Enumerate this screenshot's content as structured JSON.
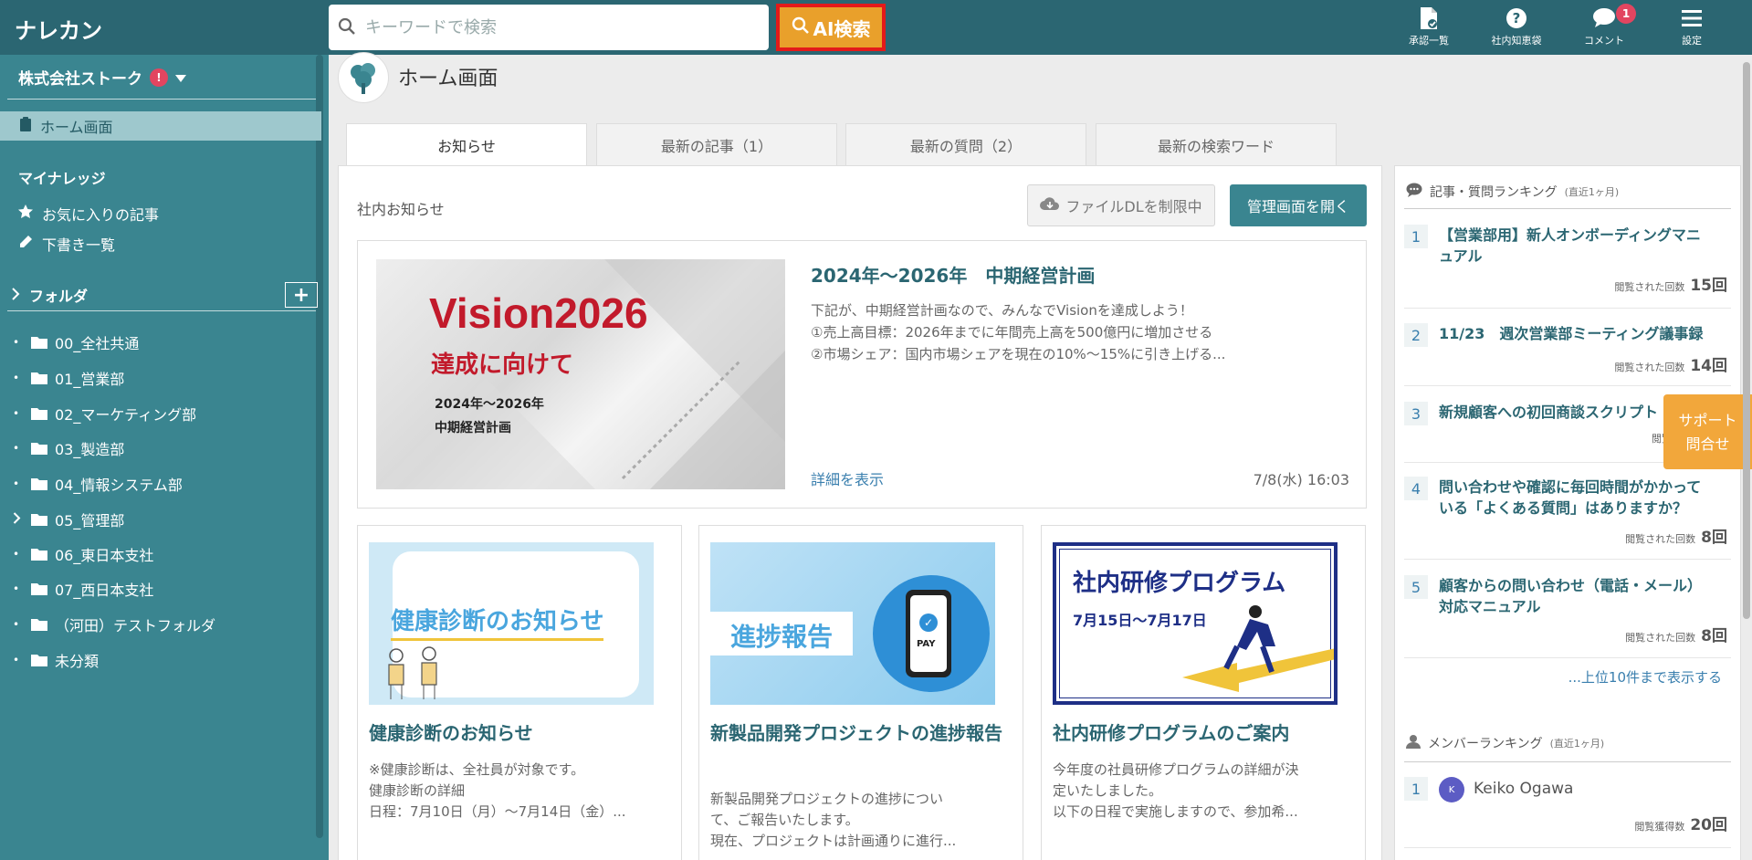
{
  "app": {
    "logo": "ナレカン"
  },
  "topbar": {
    "search_placeholder": "キーワードで検索",
    "ai_search_label": "AI検索",
    "nav": [
      {
        "label": "承認一覧",
        "icon": "approval-document-icon"
      },
      {
        "label": "社内知恵袋",
        "icon": "question-circle-icon"
      },
      {
        "label": "コメント",
        "icon": "comment-bubble-icon",
        "badge": "1"
      },
      {
        "label": "設定",
        "icon": "hamburger-menu-icon"
      }
    ]
  },
  "sidebar": {
    "company": "株式会社ストーク",
    "company_badge": "!",
    "home": "ホーム画面",
    "my_knowledge_title": "マイナレッジ",
    "favorites": "お気に入りの記事",
    "drafts": "下書き一覧",
    "folders_title": "フォルダ",
    "add_label": "+",
    "folders": [
      {
        "name": "00_全社共通",
        "expandable": false
      },
      {
        "name": "01_営業部",
        "expandable": false
      },
      {
        "name": "02_マーケティング部",
        "expandable": false
      },
      {
        "name": "03_製造部",
        "expandable": false
      },
      {
        "name": "04_情報システム部",
        "expandable": false
      },
      {
        "name": "05_管理部",
        "expandable": true
      },
      {
        "name": "06_東日本支社",
        "expandable": false
      },
      {
        "name": "07_西日本支社",
        "expandable": false
      },
      {
        "name": "（河田）テストフォルダ",
        "expandable": false
      },
      {
        "name": "未分類",
        "expandable": false
      }
    ]
  },
  "main": {
    "page_title": "ホーム画面",
    "tabs": [
      {
        "label": "お知らせ",
        "active": true
      },
      {
        "label": "最新の記事（1）",
        "active": false
      },
      {
        "label": "最新の質問（2）",
        "active": false
      },
      {
        "label": "最新の検索ワード",
        "active": false
      }
    ],
    "notice_label": "社内お知らせ",
    "file_dl_button": "ファイルDLを制限中",
    "admin_button": "管理画面を開く",
    "featured": {
      "image_title": "Vision2026",
      "image_subtitle": "達成に向けて",
      "image_line1": "2024年〜2026年",
      "image_line2": "中期経営計画",
      "title": "2024年〜2026年　中期経営計画",
      "body_line1": "下記が、中期経営計画なので、みんなでVisionを達成しよう！",
      "body_line2": "①売上高目標：2026年までに年間売上高を500億円に増加させる",
      "body_line3": "②市場シェア：国内市場シェアを現在の10%〜15%に引き上げる...",
      "detail_link": "詳細を表示",
      "date": "7/8(水) 16:03"
    },
    "cards": [
      {
        "image_text": "健康診断のお知らせ",
        "title": "健康診断のお知らせ",
        "body_line1": "※健康診断は、全社員が対象です。",
        "body_line2": "健康診断の詳細",
        "body_line3": "日程：7月10日（月）〜7月14日（金）..."
      },
      {
        "image_text": "進捗報告",
        "image_sub": "PAY",
        "title": "新製品開発プロジェクトの進捗報告",
        "body_line1": "新製品開発プロジェクトの進捗につい",
        "body_line2": "て、ご報告いたします。",
        "body_line3": "現在、プロジェクトは計画通りに進行..."
      },
      {
        "image_text": "社内研修プログラム",
        "image_sub": "7月15日〜7月17日",
        "title": "社内研修プログラムのご案内",
        "body_line1": "今年度の社員研修プログラムの詳細が決",
        "body_line2": "定いたしました。",
        "body_line3": "以下の日程で実施しますので、参加希..."
      }
    ]
  },
  "ranking": {
    "title": "記事・質問ランキング",
    "period": "(直近1ヶ月)",
    "views_label": "閲覧された回数",
    "items": [
      {
        "rank": "1",
        "title_line1": "【営業部用】新人オンボーディングマニ",
        "title_line2": "ュアル",
        "views": "15回"
      },
      {
        "rank": "2",
        "title_line1": "11/23　週次営業部ミーティング議事録",
        "title_line2": "",
        "views": "14回"
      },
      {
        "rank": "3",
        "title_line1": "新規顧客への初回商談スクリプト",
        "title_line2": "",
        "views": ""
      },
      {
        "rank": "4",
        "title_line1": "問い合わせや確認に毎回時間がかかって",
        "title_line2": "いる「よくある質問」はありますか？",
        "views": "8回"
      },
      {
        "rank": "5",
        "title_line1": "顧客からの問い合わせ（電話・メール）",
        "title_line2": "対応マニュアル",
        "views": "8回"
      }
    ],
    "more_link": "...上位10件まで表示する"
  },
  "member_ranking": {
    "title": "メンバーランキング",
    "period": "(直近1ヶ月)",
    "points_label": "閲覧獲得数",
    "items": [
      {
        "rank": "1",
        "initial": "K",
        "name": "Keiko Ogawa",
        "points": "20回"
      }
    ]
  },
  "support": {
    "line1": "サポート",
    "line2": "問合せ"
  },
  "colors": {
    "primary": "#3a8590",
    "topbar": "#2b6672",
    "accent": "#e9a02b",
    "highlight_border": "#e31a1a"
  }
}
